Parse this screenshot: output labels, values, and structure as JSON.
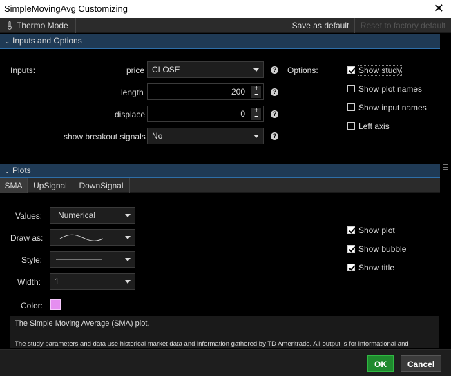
{
  "window": {
    "title": "SimpleMovingAvg Customizing",
    "close_glyph": "✕"
  },
  "toolbar": {
    "thermo_mode": "Thermo Mode",
    "save_default": "Save as default",
    "reset_default": "Reset to factory default"
  },
  "inputs_section": {
    "title": "Inputs and Options",
    "inputs_label": "Inputs:",
    "options_label": "Options:",
    "price": {
      "label": "price",
      "value": "CLOSE"
    },
    "length": {
      "label": "length",
      "value": "200"
    },
    "displace": {
      "label": "displace",
      "value": "0"
    },
    "breakout": {
      "label": "show breakout signals",
      "value": "No"
    },
    "help_glyph": "?",
    "spin_up": "+",
    "spin_down": "−",
    "options": [
      {
        "label": "Show study",
        "checked": true
      },
      {
        "label": "Show plot names",
        "checked": false
      },
      {
        "label": "Show input names",
        "checked": false
      },
      {
        "label": "Left axis",
        "checked": false
      }
    ]
  },
  "plots_section": {
    "title": "Plots",
    "tabs": [
      "SMA",
      "UpSignal",
      "DownSignal"
    ],
    "active_tab": "SMA",
    "values_label": "Values:",
    "values_value": "Numerical",
    "draw_as_label": "Draw as:",
    "style_label": "Style:",
    "width_label": "Width:",
    "width_value": "1",
    "color_label": "Color:",
    "plot_color": "#e58ef0",
    "options": [
      {
        "label": "Show plot",
        "checked": true
      },
      {
        "label": "Show bubble",
        "checked": true
      },
      {
        "label": "Show title",
        "checked": true
      }
    ]
  },
  "description": {
    "line1": "The Simple Moving Average (SMA) plot.",
    "line2": "The study parameters and data use historical market data and information gathered by TD Ameritrade. All output is for informational and"
  },
  "footer": {
    "ok": "OK",
    "cancel": "Cancel"
  },
  "colors": {
    "section_header": "#1f3a55",
    "accent": "#2e6ea8",
    "ok_green": "#1f8a2e"
  }
}
